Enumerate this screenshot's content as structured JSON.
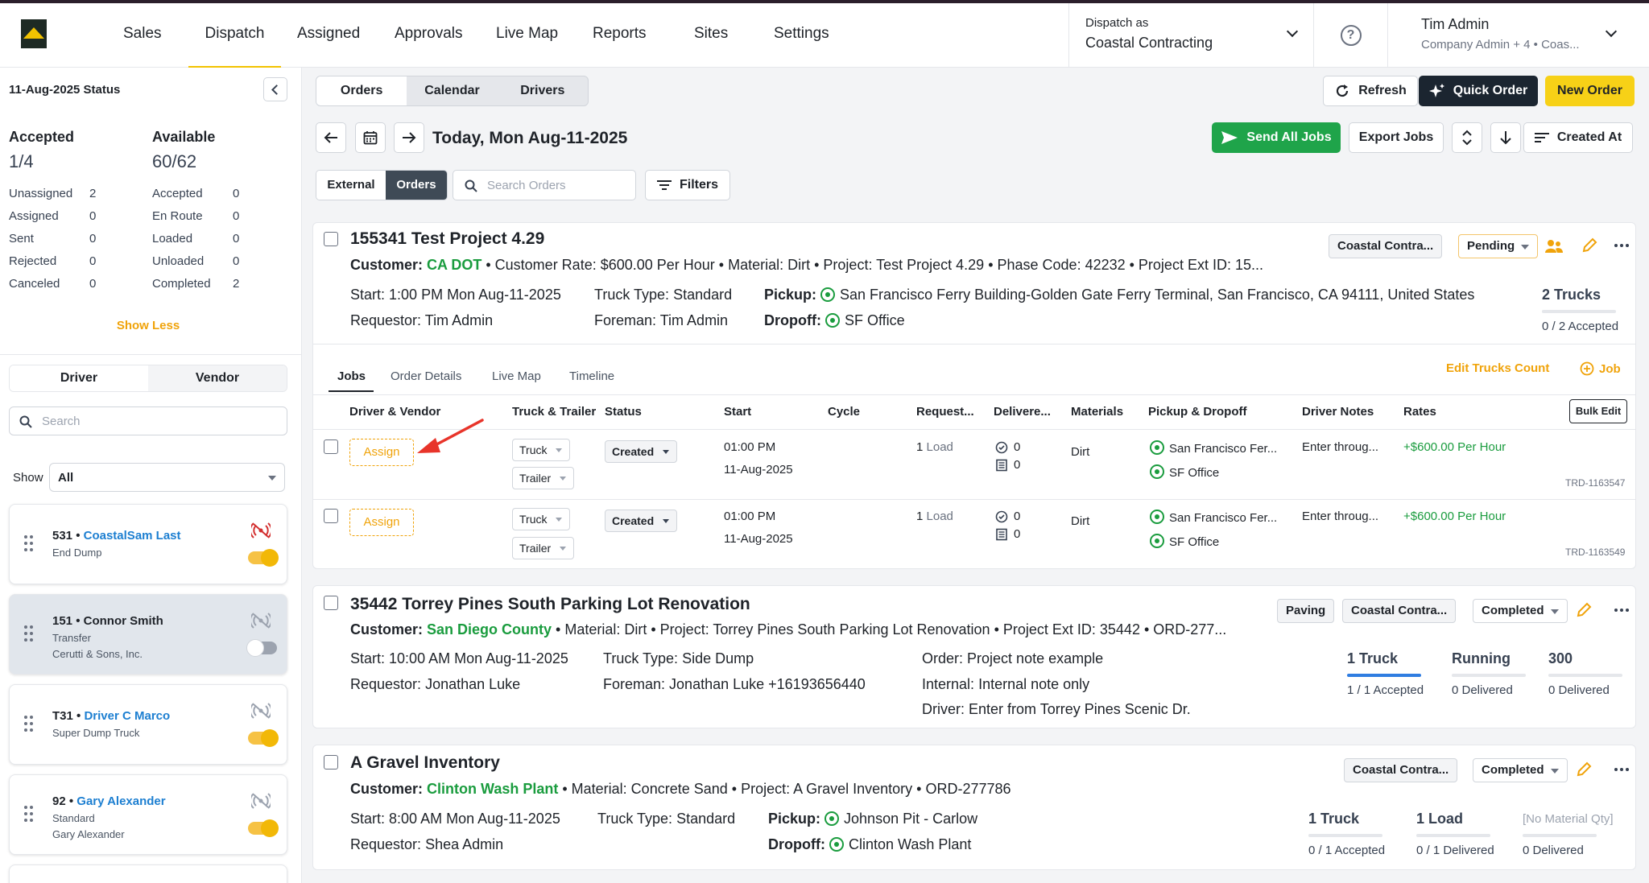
{
  "nav": {
    "items": [
      "Sales",
      "Dispatch",
      "Assigned",
      "Approvals",
      "Live Map",
      "Reports",
      "Sites",
      "Settings"
    ],
    "active": "Dispatch",
    "dispatch_as_label": "Dispatch as",
    "dispatch_as_value": "Coastal Contracting",
    "user_name": "Tim Admin",
    "user_role": "Company Admin + 4 • Coas..."
  },
  "status": {
    "title": "11-Aug-2025 Status",
    "accepted_label": "Accepted",
    "accepted_value": "1/4",
    "available_label": "Available",
    "available_value": "60/62",
    "left": [
      {
        "label": "Unassigned",
        "value": "2"
      },
      {
        "label": "Assigned",
        "value": "0"
      },
      {
        "label": "Sent",
        "value": "0"
      },
      {
        "label": "Rejected",
        "value": "0"
      },
      {
        "label": "Canceled",
        "value": "0"
      }
    ],
    "right": [
      {
        "label": "Accepted",
        "value": "0"
      },
      {
        "label": "En Route",
        "value": "0"
      },
      {
        "label": "Loaded",
        "value": "0"
      },
      {
        "label": "Unloaded",
        "value": "0"
      },
      {
        "label": "Completed",
        "value": "2"
      }
    ],
    "show_less": "Show Less"
  },
  "driver_panel": {
    "tab_driver": "Driver",
    "tab_vendor": "Vendor",
    "search_placeholder": "Search",
    "show_label": "Show",
    "show_value": "All",
    "drivers": [
      {
        "num": "531 •",
        "name": "CoastalSam Last",
        "type": "End Dump",
        "company": "",
        "name_link": true,
        "online": true
      },
      {
        "num": "151 •",
        "name": "Connor Smith",
        "type": "Transfer",
        "company": "Cerutti & Sons, Inc.",
        "name_link": false,
        "online": false
      },
      {
        "num": "T31 •",
        "name": "Driver C Marco",
        "type": "Super Dump Truck",
        "company": "",
        "name_link": true,
        "online": true
      },
      {
        "num": "92 •",
        "name": "Gary Alexander",
        "type": "Standard",
        "company": "Gary Alexander",
        "name_link": true,
        "online": true
      }
    ]
  },
  "toolbar": {
    "view_tabs": [
      "Orders",
      "Calendar",
      "Drivers"
    ],
    "refresh": "Refresh",
    "quick_order": "Quick Order",
    "new_order": "New Order",
    "date_title": "Today, Mon Aug-11-2025",
    "send_all_jobs": "Send All Jobs",
    "export_jobs": "Export Jobs",
    "sort_label": "Created At",
    "ext_tab": "External",
    "orders_tab": "Orders",
    "search_placeholder": "Search Orders",
    "filters": "Filters"
  },
  "orders": [
    {
      "title": "155341 Test Project 4.29",
      "customer_label": "Customer:",
      "customer": "CA DOT",
      "details_rest": " • Customer Rate: $600.00 Per Hour • Material: Dirt • Project: Test Project 4.29 • Phase Code: 42232 • Project Ext ID: 15...",
      "start": "1:00 PM Mon Aug-11-2025",
      "truck_type": "Standard",
      "requestor": "Tim Admin",
      "foreman": "Tim Admin",
      "pickup": "San Francisco Ferry Building-Golden Gate Ferry Terminal, San Francisco, CA 94111, United States",
      "dropoff": "SF Office",
      "company_chip": "Coastal Contra...",
      "status": "Pending",
      "trucks": "2 Trucks",
      "trucks_sub": "0 / 2 Accepted",
      "job_tabs": [
        "Jobs",
        "Order Details",
        "Live Map",
        "Timeline"
      ],
      "edit_trucks": "Edit Trucks Count",
      "add_job": "Job",
      "bulk_edit": "Bulk Edit",
      "columns": [
        "Driver & Vendor",
        "Truck & Trailer",
        "Status",
        "Start",
        "Cycle",
        "Request...",
        "Delivere...",
        "Materials",
        "Pickup & Dropoff",
        "Driver Notes",
        "Rates"
      ],
      "jobs": [
        {
          "assign": "Assign",
          "truck": "Truck",
          "trailer": "Trailer",
          "status": "Created",
          "time": "01:00 PM",
          "date": "11-Aug-2025",
          "req_num": "1",
          "req_unit": "Load",
          "d1": "0",
          "d2": "0",
          "material": "Dirt",
          "pickup": "San Francisco Fer...",
          "dropoff": "SF Office",
          "notes": "Enter throug...",
          "rate": "+$600.00 Per Hour",
          "trd": "TRD-1163547"
        },
        {
          "assign": "Assign",
          "truck": "Truck",
          "trailer": "Trailer",
          "status": "Created",
          "time": "01:00 PM",
          "date": "11-Aug-2025",
          "req_num": "1",
          "req_unit": "Load",
          "d1": "0",
          "d2": "0",
          "material": "Dirt",
          "pickup": "San Francisco Fer...",
          "dropoff": "SF Office",
          "notes": "Enter throug...",
          "rate": "+$600.00 Per Hour",
          "trd": "TRD-1163549"
        }
      ]
    },
    {
      "title": "35442 Torrey Pines South Parking Lot Renovation",
      "customer": "San Diego County",
      "details_rest": " • Material: Dirt • Project: Torrey Pines South Parking Lot Renovation • Project Ext ID: 35442 • ORD-277...",
      "start": "10:00 AM Mon Aug-11-2025",
      "truck_type": "Side Dump",
      "requestor": "Jonathan Luke",
      "foreman": "Jonathan Luke +16193656440",
      "order_note": "Project note example",
      "internal_note": "Internal note only",
      "driver_note": "Enter from Torrey Pines Scenic Dr.",
      "tag": "Paving",
      "company_chip": "Coastal Contra...",
      "status": "Completed",
      "m1": "1 Truck",
      "m1s": "1 / 1 Accepted",
      "m2": "Running",
      "m2s": "0 Delivered",
      "m3": "300",
      "m3s": "0 Delivered"
    },
    {
      "title": "A Gravel Inventory",
      "customer": "Clinton Wash Plant",
      "details_rest": " • Material: Concrete Sand • Project: A Gravel Inventory • ORD-277786",
      "start": "8:00 AM Mon Aug-11-2025",
      "truck_type": "Standard",
      "requestor": "Shea Admin",
      "pickup": "Johnson Pit - Carlow",
      "dropoff": "Clinton Wash Plant",
      "company_chip": "Coastal Contra...",
      "status": "Completed",
      "m1": "1 Truck",
      "m1s": "0 / 1 Accepted",
      "m2": "1 Load",
      "m2s": "0 / 1 Delivered",
      "m3": "[No Material Qty]",
      "m3s": "0 Delivered"
    }
  ],
  "labels": {
    "customer": "Customer:",
    "start": "Start:",
    "truck_type": "Truck Type:",
    "pickup": "Pickup:",
    "dropoff": "Dropoff:",
    "requestor": "Requestor:",
    "foreman": "Foreman:",
    "order": "Order:",
    "internal": "Internal:",
    "driver": "Driver:"
  },
  "colors": {
    "accent_yellow": "#f7d117",
    "green": "#1a9c3e",
    "link_blue": "#1d7fd1",
    "orange": "#f0a30a",
    "dark": "#1b2530"
  }
}
